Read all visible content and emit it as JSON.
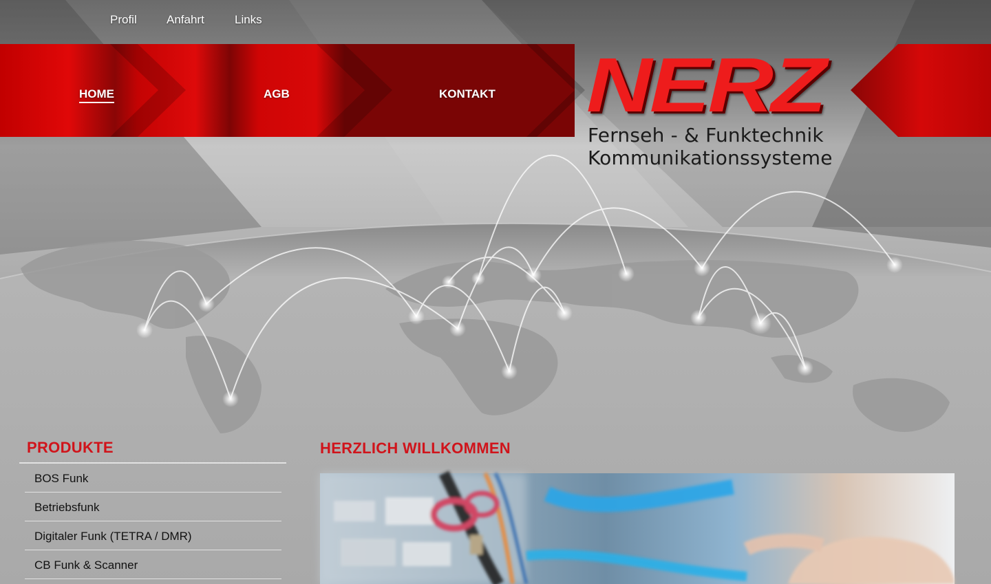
{
  "top_nav": [
    "Profil",
    "Anfahrt",
    "Links"
  ],
  "main_nav": {
    "items": [
      "HOME",
      "AGB",
      "KONTAKT"
    ],
    "active": "HOME"
  },
  "logo": {
    "word": "NERZ",
    "line1": "Fernseh - & Funktechnik",
    "line2": "Kommunikationssysteme"
  },
  "sidebar": {
    "heading": "PRODUKTE",
    "items": [
      "BOS Funk",
      "Betriebsfunk",
      "Digitaler Funk (TETRA / DMR)",
      "CB Funk & Scanner"
    ]
  },
  "main": {
    "heading": "HERZLICH WILLKOMMEN"
  },
  "colors": {
    "brand_red": "#d0141b",
    "logo_red": "#ee1c1c",
    "background_gray": "#a9a9a9"
  }
}
